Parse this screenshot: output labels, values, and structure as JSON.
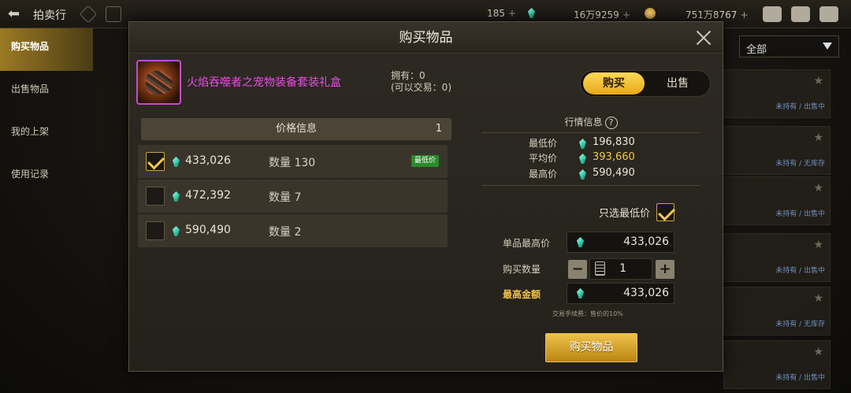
{
  "topbar": {
    "title": "拍卖行",
    "currency_a": "185",
    "currency_b": "16万9259",
    "currency_c": "751万8767"
  },
  "left_nav": [
    "购买物品",
    "出售物品",
    "我的上架",
    "使用记录"
  ],
  "filter": {
    "selected": "全部"
  },
  "bg_rows": {
    "sub_owned_selling": "未持有 / 出售中",
    "sub_owned_none": "未持有 / 无库存"
  },
  "modal": {
    "title": "购买物品",
    "item_name": "火焰吞噬者之宠物装备套装礼盒",
    "owned": "拥有：0",
    "tradable": "(可以交易：0)",
    "toggle": {
      "buy": "购买",
      "sell": "出售",
      "active": "buy"
    },
    "price_header": "价格信息",
    "page": "1",
    "rows": [
      {
        "price": "433,026",
        "qty": "数量 130",
        "badge": "最低价",
        "checked": true
      },
      {
        "price": "472,392",
        "qty": "数量 7",
        "badge": "",
        "checked": false
      },
      {
        "price": "590,490",
        "qty": "数量 2",
        "badge": "",
        "checked": false
      }
    ],
    "market": {
      "title": "行情信息",
      "min_label": "最低价",
      "min": "196,830",
      "avg_label": "平均价",
      "avg": "393,660",
      "max_label": "最高价",
      "max": "590,490"
    },
    "only_lowest": "只选最低价",
    "unit_max_label": "单品最高价",
    "unit_max": "433,026",
    "quantity_label": "购买数量",
    "quantity": "1",
    "total_label": "最高金额",
    "total": "433,026",
    "fee_note": "交易手续费：售价的10%",
    "buy_button": "购买物品"
  },
  "colors": {
    "accent_gold": "#f0c24a",
    "item_name": "#e84de4",
    "badge_green": "#2a8a2c"
  }
}
